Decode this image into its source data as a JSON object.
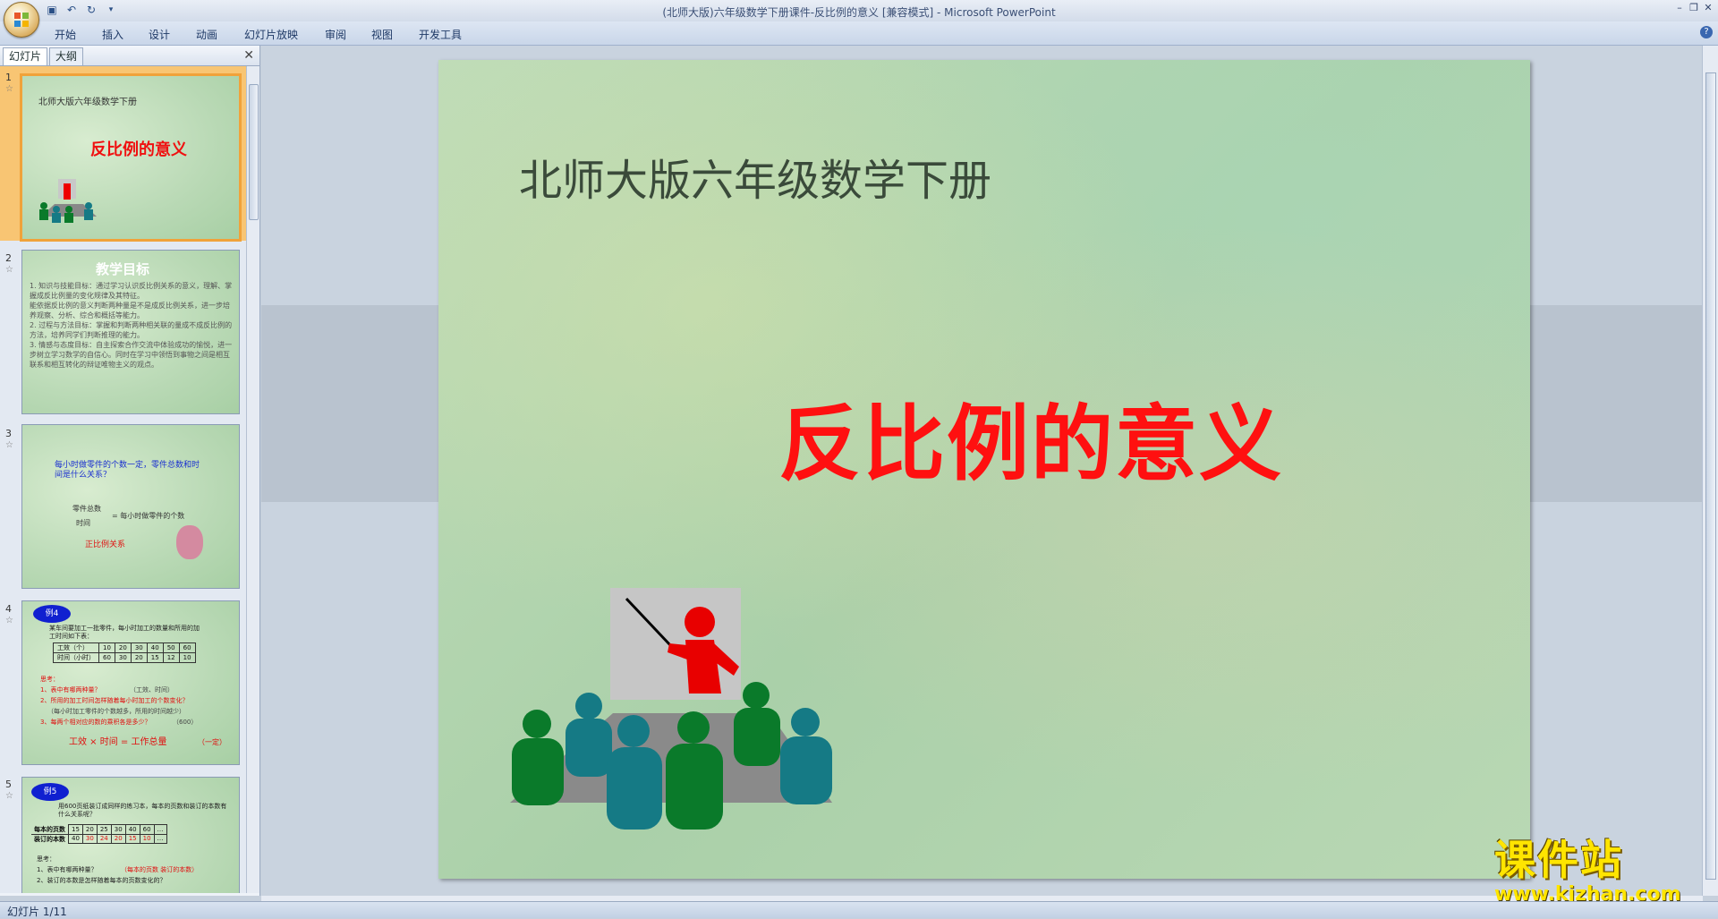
{
  "window": {
    "title": "(北师大版)六年级数学下册课件-反比例的意义 [兼容模式] - Microsoft PowerPoint"
  },
  "ribbon": {
    "tabs": [
      "开始",
      "插入",
      "设计",
      "动画",
      "幻灯片放映",
      "审阅",
      "视图",
      "开发工具"
    ]
  },
  "panel": {
    "tabs": [
      "幻灯片",
      "大纲"
    ],
    "slides": [
      {
        "num": "1",
        "subtitle": "北师大版六年级数学下册",
        "title": "反比例的意义"
      },
      {
        "num": "2",
        "title": "教学目标",
        "lines": [
          "1. 知识与技能目标：通过学习认识反比例关系的意义，理解、掌握成反比例量的变化规律及其特征。",
          "能依据反比例的意义判断两种量是不是成反比例关系，进一步培养观察、分析、综合和概括等能力。",
          "2. 过程与方法目标：掌握和判断两种相关联的量成不成反比例的方法，培养同学们判断推理的能力。",
          "3. 情感与态度目标：自主探索合作交流中体验成功的愉悦，进一步树立学习数学的自信心。同时在学习中领悟到事物之间是相互联系和相互转化的辩证唯物主义的观点。"
        ]
      },
      {
        "num": "3",
        "question": "每小时做零件的个数一定，零件总数和时间是什么关系？",
        "label1": "零件总数",
        "label2": "时间",
        "label3": "= 每小时做零件的个数",
        "answer": "正比例关系"
      },
      {
        "num": "4",
        "badge": "例4",
        "intro": "某车间要加工一批零件，每小时加工的数量和所用的加工时间如下表：",
        "row1": [
          "工效（个）",
          "10",
          "20",
          "30",
          "40",
          "50",
          "60"
        ],
        "row2": [
          "时间（小时）",
          "60",
          "30",
          "20",
          "15",
          "12",
          "10"
        ],
        "think": "思考：",
        "q1": "1、表中有哪两种量？",
        "a1": "（工效、时间）",
        "q2": "2、所用的加工时间怎样随着每小时加工的个数变化？",
        "q3": "（每小时加工零件的个数越多，所用的时间越少）",
        "q4": "3、每两个相对应的数的乘积各是多少？",
        "a4": "（600）",
        "formula": "工效 × 时间 = 工作总量",
        "const": "（一定）"
      },
      {
        "num": "5",
        "badge": "例5",
        "intro": "用600页纸装订成同样的练习本，每本的页数和装订的本数有什么关系呢？",
        "row1": [
          "每本的页数",
          "15",
          "20",
          "25",
          "30",
          "40",
          "60",
          "…"
        ],
        "row2": [
          "装订的本数",
          "40",
          "30",
          "24",
          "20",
          "15",
          "10",
          "…"
        ],
        "think": "思考：",
        "q1": "1、表中有哪两种量？",
        "a1": "（每本的页数  装订的本数）",
        "q2": "2、装订的本数是怎样随着每本的页数变化的？"
      }
    ]
  },
  "slide": {
    "subtitle": "北师大版六年级数学下册",
    "title": "反比例的意义"
  },
  "status": {
    "slide_info": "幻灯片 1/11"
  },
  "watermark": {
    "main": "课件站",
    "url": "www.kjzhan.com"
  }
}
